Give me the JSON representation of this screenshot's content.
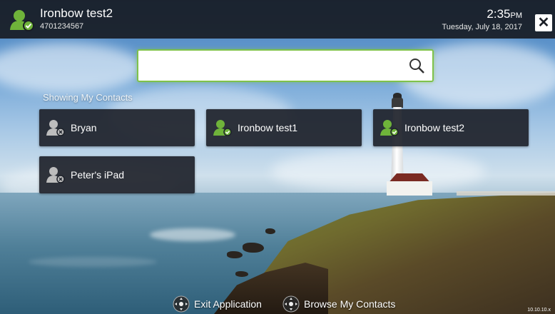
{
  "header": {
    "user_name": "Ironbow test2",
    "user_number": "4701234567",
    "time": "2:35",
    "ampm": "PM",
    "date": "Tuesday, July 18, 2017",
    "close_label": "✕",
    "avatar_icon": "contact-online-icon",
    "status_color": "#7fc24a"
  },
  "search": {
    "value": "",
    "placeholder": "",
    "icon": "search-icon"
  },
  "contacts": {
    "section_label": "Showing My Contacts",
    "items": [
      {
        "label": "Bryan",
        "status": "offline",
        "icon": "contact-offline-icon"
      },
      {
        "label": "Ironbow test1",
        "status": "online",
        "icon": "contact-online-icon"
      },
      {
        "label": "Ironbow test2",
        "status": "online",
        "icon": "contact-online-icon"
      },
      {
        "label": "Peter's iPad",
        "status": "offline",
        "icon": "contact-offline-icon"
      }
    ]
  },
  "footer": {
    "exit_label": "Exit Application",
    "browse_label": "Browse My Contacts",
    "ip": "10.10.10.x",
    "dpad_icon": "dpad-icon"
  },
  "colors": {
    "online_green": "#6fb33a",
    "tile_bg": "#1e222a",
    "topbar_bg": "#181c24"
  }
}
